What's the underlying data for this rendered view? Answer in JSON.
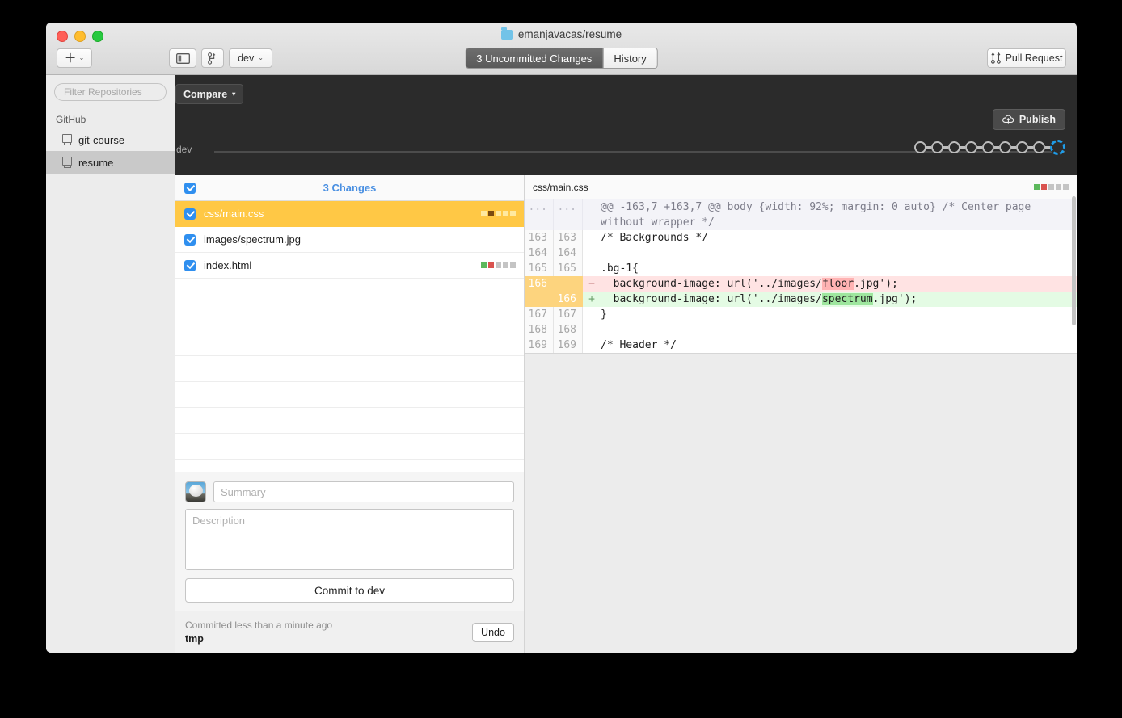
{
  "window": {
    "title": "emanjavacas/resume",
    "folder_icon": "folder-icon",
    "traffic_lights": [
      "close",
      "minimize",
      "zoom"
    ]
  },
  "toolbar": {
    "add_label": "+",
    "add_caret": "⌄",
    "sidebar_toggle_icon": "sidebar-toggle-icon",
    "new_branch_icon": "new-branch-icon",
    "branch_name": "dev",
    "branch_caret": "⌄",
    "pull_request_label": "Pull Request",
    "pull_request_icon": "pull-request-icon",
    "tabs": [
      {
        "label": "3 Uncommitted Changes",
        "active": true
      },
      {
        "label": "History",
        "active": false
      }
    ]
  },
  "darkbar": {
    "compare_label": "Compare",
    "compare_caret": "▾",
    "publish_label": "Publish",
    "publish_icon": "cloud-upload-icon",
    "branch_label": "dev",
    "commit_nodes": 8,
    "current_node": "in-progress",
    "accent_blue": "#1f9ce8"
  },
  "sidebar": {
    "filter_placeholder": "Filter Repositories",
    "section_label": "GitHub",
    "repos": [
      {
        "name": "git-course",
        "selected": false
      },
      {
        "name": "resume",
        "selected": true
      }
    ]
  },
  "changes": {
    "header_label": "3 Changes",
    "header_checked": true,
    "files": [
      {
        "name": "css/main.css",
        "checked": true,
        "selected": true,
        "stats": [
          "#ffe9a0",
          "#7a4a10",
          "#ffe9a0",
          "#ffe9a0",
          "#ffe9a0"
        ]
      },
      {
        "name": "images/spectrum.jpg",
        "checked": true,
        "selected": false,
        "stats": []
      },
      {
        "name": "index.html",
        "checked": true,
        "selected": false,
        "stats": [
          "#5cb85c",
          "#d9534f",
          "#c4c4c4",
          "#c4c4c4",
          "#c4c4c4"
        ]
      }
    ],
    "blank_rows": 8
  },
  "commit_form": {
    "avatar": "user-avatar",
    "summary_placeholder": "Summary",
    "summary_value": "",
    "description_placeholder": "Description",
    "description_value": "",
    "commit_button_label": "Commit to dev"
  },
  "undo_bar": {
    "status_text": "Committed less than a minute ago",
    "commit_message": "tmp",
    "undo_label": "Undo"
  },
  "diff": {
    "file_name": "css/main.css",
    "stats": [
      "#5cb85c",
      "#d9534f",
      "#c4c4c4",
      "#c4c4c4",
      "#c4c4c4"
    ],
    "lines": [
      {
        "type": "hunk",
        "old_num": "...",
        "new_num": "...",
        "sign": "",
        "text": "@@ -163,7 +163,7 @@ body {width: 92%; margin: 0 auto} /* Center page without wrapper */"
      },
      {
        "type": "ctx",
        "old_num": "163",
        "new_num": "163",
        "sign": "",
        "text": "/* Backgrounds */"
      },
      {
        "type": "ctx",
        "old_num": "164",
        "new_num": "164",
        "sign": "",
        "text": ""
      },
      {
        "type": "ctx",
        "old_num": "165",
        "new_num": "165",
        "sign": "",
        "text": ".bg-1{"
      },
      {
        "type": "del",
        "old_num": "166",
        "new_num": "",
        "sign": "−",
        "text_pre": "  background-image: url('../images/",
        "text_hl": "floor",
        "text_post": ".jpg');"
      },
      {
        "type": "add",
        "old_num": "",
        "new_num": "166",
        "sign": "+",
        "text_pre": "  background-image: url('../images/",
        "text_hl": "spectrum",
        "text_post": ".jpg');"
      },
      {
        "type": "ctx",
        "old_num": "167",
        "new_num": "167",
        "sign": "",
        "text": "}"
      },
      {
        "type": "ctx",
        "old_num": "168",
        "new_num": "168",
        "sign": "",
        "text": ""
      },
      {
        "type": "ctx",
        "old_num": "169",
        "new_num": "169",
        "sign": "",
        "text": "/* Header */"
      }
    ]
  }
}
